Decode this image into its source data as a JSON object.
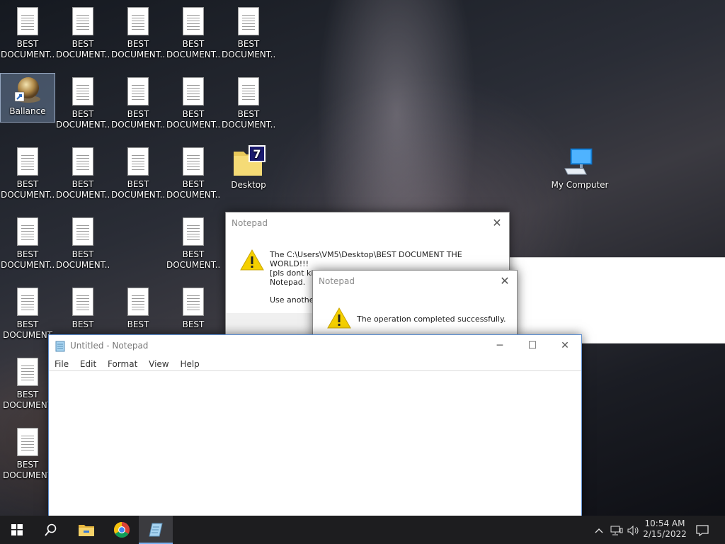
{
  "desktop": {
    "doc_label_line1": "BEST",
    "doc_label_line2": "DOCUMENT...",
    "doc_label_line2_clipped": "DOCUMENT",
    "ballance_label": "Ballance",
    "desktop_folder_label": "Desktop",
    "my_computer_label": "My Computer"
  },
  "dialog_back": {
    "title": "Notepad",
    "message_line1": "The C:\\Users\\VM5\\Desktop\\BEST DOCUMENT THE WORLD!!!",
    "message_line2": "[pls dont kill me] - Copy - C",
    "message_line3": "Notepad.",
    "message_line4": "Use anothe"
  },
  "dialog_front": {
    "title": "Notepad",
    "message": "The operation completed successfully."
  },
  "notepad": {
    "title": "Untitled - Notepad",
    "menu": [
      "File",
      "Edit",
      "Format",
      "View",
      "Help"
    ],
    "content": ""
  },
  "taskbar": {
    "time": "10:54 AM",
    "date": "2/15/2022"
  },
  "colors": {
    "accent": "#0078d7",
    "warning_yellow": "#f5d000",
    "taskbar_bg": "#1d1d1f"
  },
  "icons": [
    "windows-start-icon",
    "search-icon",
    "file-explorer-icon",
    "chrome-icon",
    "notepad-icon",
    "chevron-up-icon",
    "network-icon",
    "volume-icon",
    "notification-icon",
    "warning-icon"
  ]
}
